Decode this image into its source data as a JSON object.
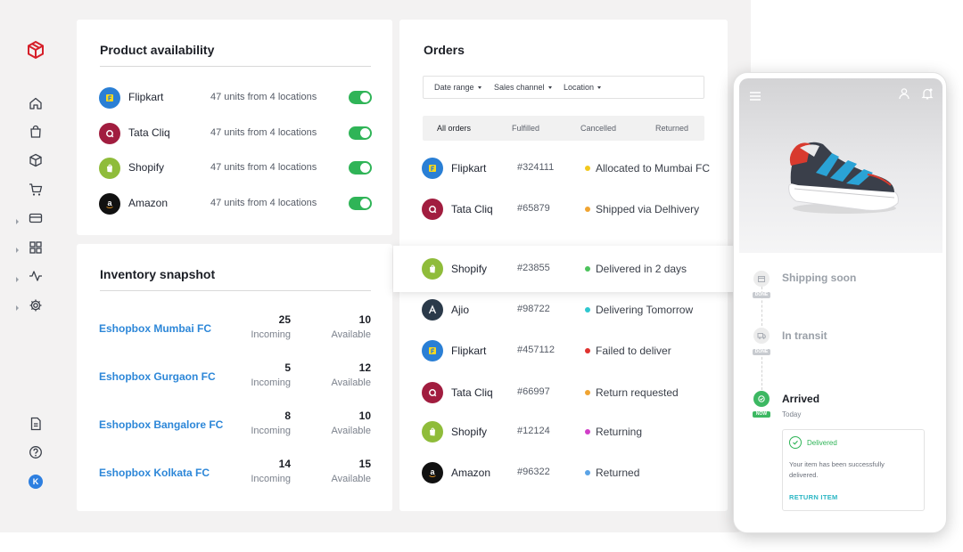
{
  "availability": {
    "title": "Product availability",
    "rows": [
      {
        "name": "Flipkart",
        "units": "47 units from 4 locations"
      },
      {
        "name": "Tata Cliq",
        "units": "47 units from 4 locations"
      },
      {
        "name": "Shopify",
        "units": "47 units from 4 locations"
      },
      {
        "name": "Amazon",
        "units": "47 units from 4 locations"
      }
    ]
  },
  "inventory": {
    "title": "Inventory snapshot",
    "incoming_label": "Incoming",
    "available_label": "Available",
    "rows": [
      {
        "location": "Eshopbox Mumbai FC",
        "incoming": "25",
        "available": "10"
      },
      {
        "location": "Eshopbox Gurgaon FC",
        "incoming": "5",
        "available": "12"
      },
      {
        "location": "Eshopbox Bangalore FC",
        "incoming": "8",
        "available": "10"
      },
      {
        "location": "Eshopbox Kolkata FC",
        "incoming": "14",
        "available": "15"
      }
    ]
  },
  "orders": {
    "title": "Orders",
    "filters": [
      "Date range",
      "Sales channel",
      "Location"
    ],
    "tabs": [
      "All orders",
      "Fulfilled",
      "Cancelled",
      "Returned"
    ],
    "rows": [
      {
        "channel": "Flipkart",
        "id": "#324111",
        "status": "Allocated to Mumbai FC",
        "dot": "#f2c81d"
      },
      {
        "channel": "Tata Cliq",
        "id": "#65879",
        "status": "Shipped via Delhivery",
        "dot": "#f0a431"
      },
      {
        "channel": "Shopify",
        "id": "#23855",
        "status": "Delivered in 2 days",
        "dot": "#4cc35c"
      },
      {
        "channel": "Ajio",
        "id": "#98722",
        "status": "Delivering Tomorrow",
        "dot": "#2ec7cf"
      },
      {
        "channel": "Flipkart",
        "id": "#457112",
        "status": "Failed to deliver",
        "dot": "#e0322f"
      },
      {
        "channel": "Tata Cliq",
        "id": "#66997",
        "status": "Return requested",
        "dot": "#f0a431"
      },
      {
        "channel": "Shopify",
        "id": "#12124",
        "status": "Returning",
        "dot": "#d13ec8"
      },
      {
        "channel": "Amazon",
        "id": "#96322",
        "status": "Returned",
        "dot": "#5aa3e6"
      }
    ]
  },
  "tracking": {
    "steps": [
      {
        "title": "Shipping soon",
        "tag": "DONE"
      },
      {
        "title": "In transit",
        "tag": "DONE"
      },
      {
        "title": "Arrived",
        "tag": "NOW",
        "sub": "Today"
      }
    ],
    "delivered": {
      "title": "Delivered",
      "message": "Your item has been successfully delivered.",
      "action": "RETURN ITEM"
    }
  },
  "user": {
    "initial": "K"
  },
  "colors": {
    "toggle_on": "#2fb457",
    "link": "#2d87d8",
    "flipkart": "#2a7fd5",
    "tatacliq": "#a11d3f",
    "shopify": "#8fbc3a",
    "amazon": "#111111",
    "ajio": "#2b3a4a"
  }
}
